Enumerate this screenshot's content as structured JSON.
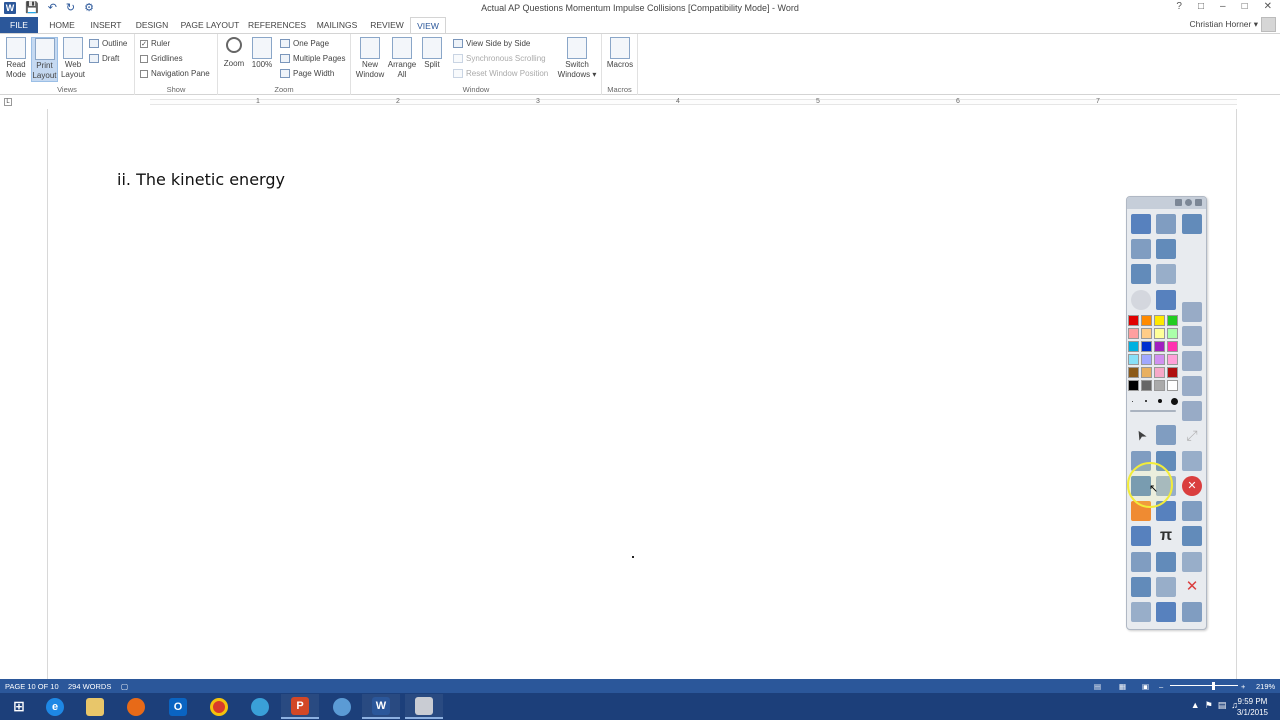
{
  "window": {
    "title": "Actual AP Questions Momentum Impulse Collisions [Compatibility Mode] - Word",
    "controls": [
      "?",
      "□",
      "–",
      "□",
      "✕"
    ],
    "user_name": "Christian Horner ▾"
  },
  "tabs": [
    "FILE",
    "HOME",
    "INSERT",
    "DESIGN",
    "PAGE LAYOUT",
    "REFERENCES",
    "MAILINGS",
    "REVIEW",
    "VIEW"
  ],
  "ribbon": {
    "views": {
      "label": "Views",
      "read_mode": "Read Mode",
      "print_layout": "Print Layout",
      "web_layout": "Web Layout",
      "outline": "Outline",
      "draft": "Draft"
    },
    "show": {
      "label": "Show",
      "ruler": "Ruler",
      "gridlines": "Gridlines",
      "navigation_pane": "Navigation Pane",
      "ruler_checked": true
    },
    "zoom": {
      "label": "Zoom",
      "zoom": "Zoom",
      "hundred": "100%",
      "one_page": "One Page",
      "multiple_pages": "Multiple Pages",
      "page_width": "Page Width"
    },
    "window": {
      "label": "Window",
      "new_window": "New Window",
      "arrange_all": "Arrange All",
      "split": "Split",
      "view_side_by_side": "View Side by Side",
      "synchronous_scrolling": "Synchronous Scrolling",
      "reset_window_position": "Reset Window Position",
      "switch_windows": "Switch Windows ▾"
    },
    "macros": {
      "label": "Macros",
      "macros": "Macros"
    }
  },
  "ruler": {
    "numbers": [
      "1",
      "2",
      "3",
      "4",
      "5",
      "6",
      "7"
    ]
  },
  "document": {
    "text": "ii. The kinetic energy"
  },
  "pen_toolbar": {
    "colors": [
      [
        "#e00000",
        "#ff8a00",
        "#ffe800",
        "#22cc22"
      ],
      [
        "#ff9f9f",
        "#ffcc88",
        "#ffff99",
        "#aaffaa"
      ],
      [
        "#00b0e0",
        "#0030d0",
        "#a020c0",
        "#ff30b0"
      ],
      [
        "#88e0f8",
        "#a0a8ff",
        "#d090f0",
        "#ffa0d8"
      ],
      [
        "#8b5a1a",
        "#e8b060",
        "#f7a8c8",
        "#b01010"
      ],
      [
        "#000000",
        "#666666",
        "#aaaaaa",
        "#ffffff"
      ]
    ]
  },
  "status_bar": {
    "page": "PAGE 10 OF 10",
    "words": "294 WORDS",
    "zoom": "219%",
    "zoom_fraction": 0.62
  },
  "taskbar": {
    "time": "9:59 PM",
    "date": "3/1/2015"
  }
}
